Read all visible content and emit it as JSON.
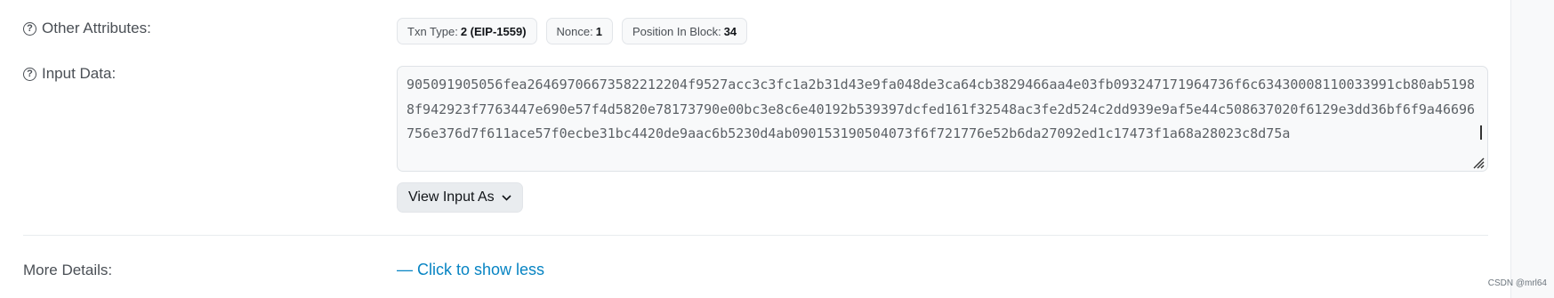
{
  "other_attributes": {
    "label": "Other Attributes:",
    "badges": [
      {
        "key": "Txn Type:",
        "value": "2 (EIP-1559)"
      },
      {
        "key": "Nonce:",
        "value": "1"
      },
      {
        "key": "Position In Block:",
        "value": "34"
      }
    ]
  },
  "input_data": {
    "label": "Input Data:",
    "value": "905091905056fea2646970667358221220 4f9527acc3c3fc1a2b31d43e9fa048de3ca64cb3829466aa4e03fb093247171964736f6c63430008110033991cb80ab51988f942923f7763447e690e57f4d5820e78173790e00bc3e8c6e40192b539397dcfed161f32548ac3fe2d524c2dd939e9af5e44c508637020f6129e3dd36bf6f9a46696756e376d7f611ace57f0ecbe31bc4420de9aac6b5230d4ab090153190504073f6f721776e52b6da27092ed1c17473f1a68a28023c8d75a",
    "view_button": "View Input As"
  },
  "more_details": {
    "label": "More Details:",
    "link": "— Click to show less"
  },
  "watermark": "CSDN @mrl64",
  "colors": {
    "link": "#0784c3",
    "label": "#4a4f55",
    "input_bg": "#f8f9fa"
  },
  "icons": [
    "help-circle-icon",
    "chevron-down-icon",
    "resize-handle-icon"
  ]
}
